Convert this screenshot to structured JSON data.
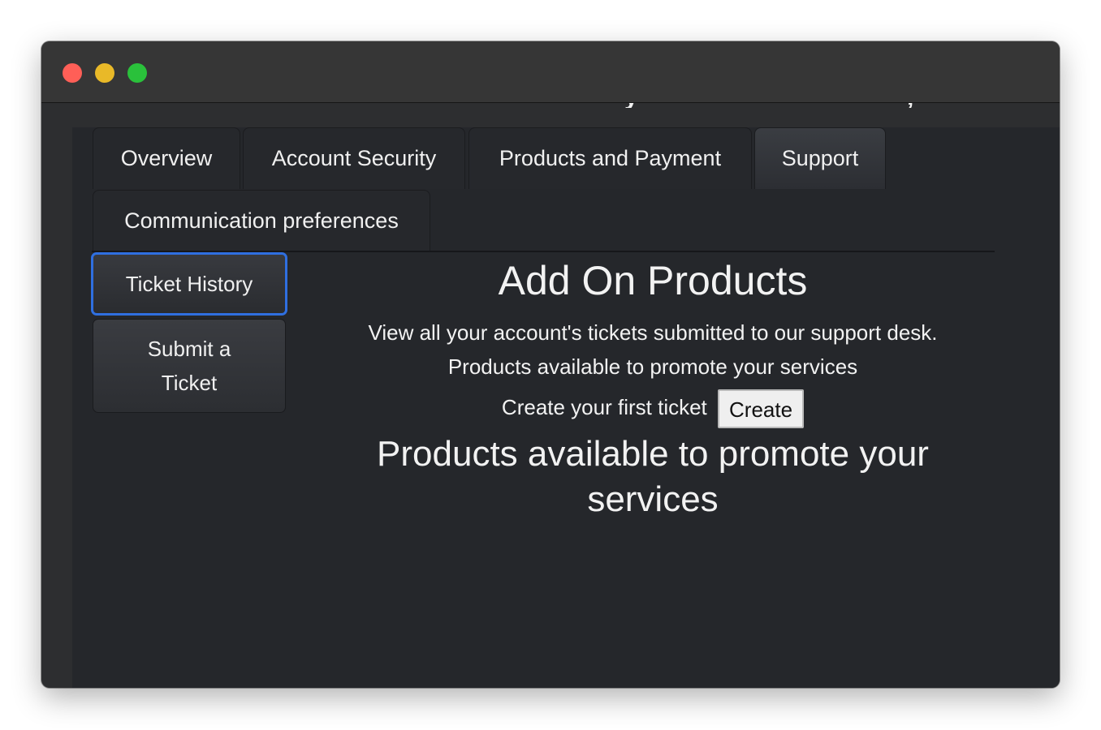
{
  "window": {
    "controls": {
      "close_color": "#ff5f57",
      "minimize_color": "#e9b928",
      "zoom_color": "#2ac13b"
    }
  },
  "tabs": [
    {
      "label": "Overview",
      "active": false
    },
    {
      "label": "Account Security",
      "active": false
    },
    {
      "label": "Products and Payment",
      "active": false
    },
    {
      "label": "Support",
      "active": true
    },
    {
      "label": "Communication preferences",
      "active": false
    }
  ],
  "sidebar": {
    "items": [
      {
        "label": "Ticket History",
        "selected": true
      },
      {
        "label": "Submit a Ticket",
        "selected": false
      }
    ]
  },
  "main": {
    "title": "Add On Products",
    "description": "View all your account's tickets submitted to our support desk.",
    "subtext": "Products available to promote your services",
    "create_prompt": "Create your first ticket",
    "create_button": "Create",
    "section_heading": "Products available to promote your services"
  },
  "colors": {
    "background": "#25272b",
    "text": "#f2f2f2",
    "focus": "#2f6fe0"
  }
}
